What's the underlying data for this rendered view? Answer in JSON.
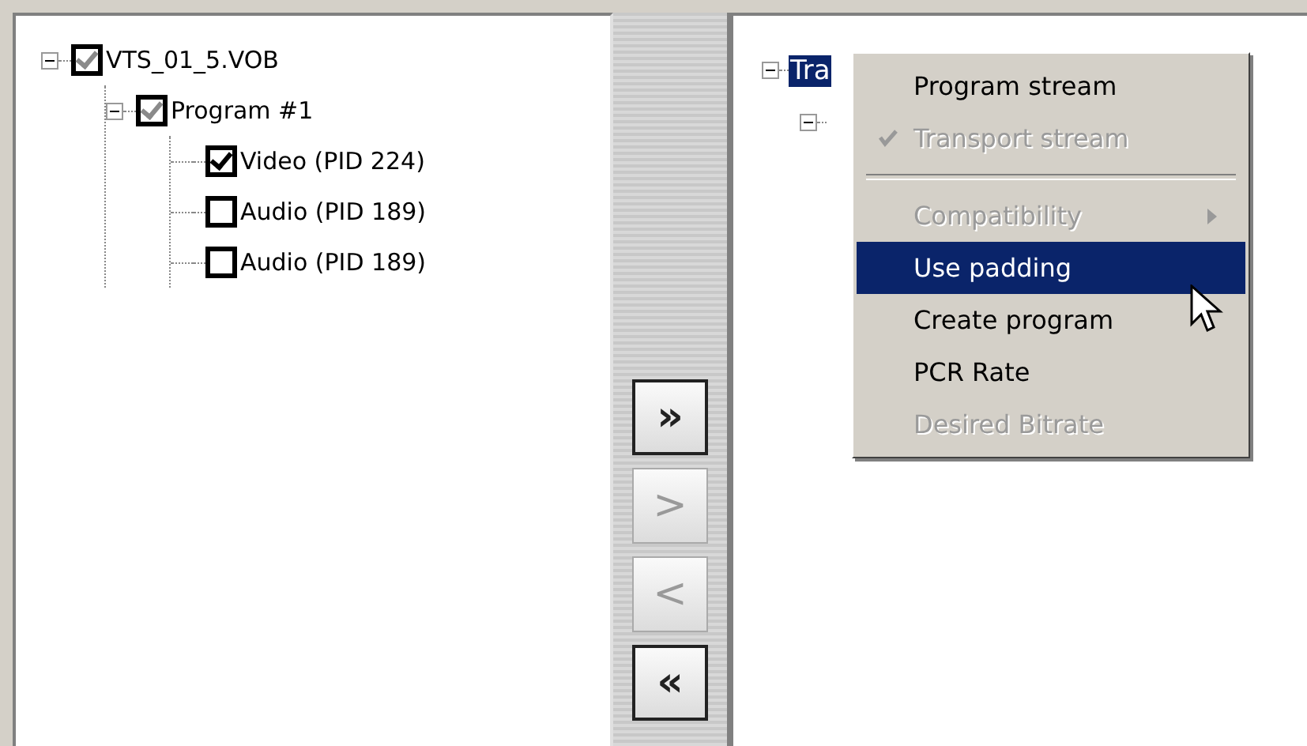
{
  "source_tree": [
    {
      "label": "VTS_01_5.VOB",
      "expanded": true,
      "checked": true,
      "mixed": true,
      "children": [
        {
          "label": "Program #1",
          "expanded": true,
          "checked": true,
          "mixed": true,
          "children": [
            {
              "label": "Video (PID 224)",
              "checked": true
            },
            {
              "label": "Audio (PID 189)",
              "checked": false
            },
            {
              "label": "Audio (PID 189)",
              "checked": false
            }
          ]
        }
      ]
    }
  ],
  "move_buttons": [
    {
      "symbol": "»",
      "disabled": false
    },
    {
      "symbol": ">",
      "disabled": true
    },
    {
      "symbol": "<",
      "disabled": true
    },
    {
      "symbol": "«",
      "disabled": false
    }
  ],
  "output_tree": [
    {
      "label": "Tra",
      "expanded": true,
      "selected": true,
      "children": [
        {
          "expanded": true
        }
      ]
    }
  ],
  "context_menu": [
    {
      "kind": "item",
      "label": "Program stream",
      "disabled": false,
      "selected": false
    },
    {
      "kind": "item",
      "label": "Transport stream",
      "disabled": true,
      "checked": true,
      "selected": false
    },
    {
      "kind": "separator"
    },
    {
      "kind": "item",
      "label": "Compatibility",
      "disabled": true,
      "submenu": true,
      "selected": false
    },
    {
      "kind": "item",
      "label": "Use padding",
      "disabled": false,
      "selected": true
    },
    {
      "kind": "item",
      "label": "Create program",
      "disabled": false,
      "selected": false
    },
    {
      "kind": "item",
      "label": "PCR Rate",
      "disabled": false,
      "selected": false
    },
    {
      "kind": "item",
      "label": "Desired Bitrate",
      "disabled": true,
      "selected": false
    }
  ]
}
